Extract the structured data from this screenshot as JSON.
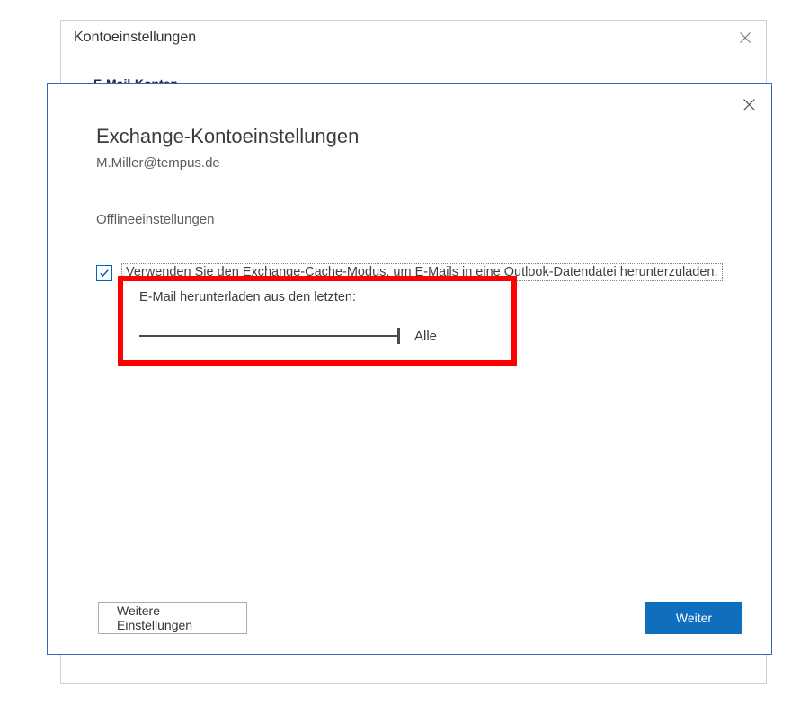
{
  "back_dialog": {
    "title": "Kontoeinstellungen",
    "subtitle": "E-Mail-Konten"
  },
  "front_dialog": {
    "title": "Exchange-Kontoeinstellungen",
    "email": "M.Miller@tempus.de",
    "section": "Offlineeinstellungen",
    "checkbox_label": "Verwenden Sie den Exchange-Cache-Modus, um E-Mails in eine Outlook-Datendatei herunterzuladen.",
    "slider": {
      "label": "E-Mail herunterladen aus den letzten:",
      "value_label": "Alle"
    },
    "buttons": {
      "secondary": "Weitere Einstellungen",
      "primary": "Weiter"
    }
  }
}
